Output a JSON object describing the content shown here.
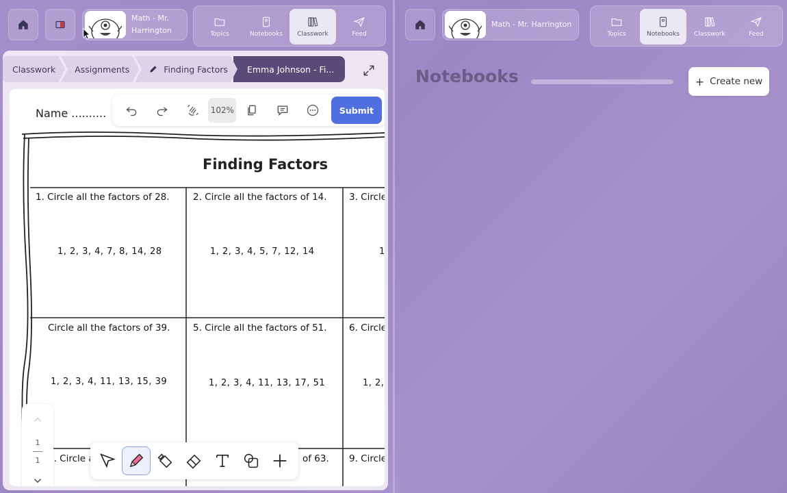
{
  "left_header": {
    "course": "Math - Mr. Harrington",
    "nav": [
      {
        "label": "Topics",
        "icon": "folder-icon",
        "active": false
      },
      {
        "label": "Notebooks",
        "icon": "notebook-icon",
        "active": false
      },
      {
        "label": "Classwork",
        "icon": "books-icon",
        "active": true
      },
      {
        "label": "Feed",
        "icon": "paper-plane-icon",
        "active": false
      }
    ]
  },
  "right_header": {
    "course": "Math - Mr. Harrington",
    "nav": [
      {
        "label": "Topics",
        "icon": "folder-icon",
        "active": false
      },
      {
        "label": "Notebooks",
        "icon": "notebook-icon",
        "active": true
      },
      {
        "label": "Classwork",
        "icon": "books-icon",
        "active": false
      },
      {
        "label": "Feed",
        "icon": "paper-plane-icon",
        "active": false
      }
    ]
  },
  "breadcrumbs": [
    "Classwork",
    "Assignments",
    "Finding Factors",
    "Emma Johnson - Fi..."
  ],
  "toolbar": {
    "zoom": "102%",
    "submit": "Submit"
  },
  "worksheet": {
    "name_label": "Name ..........",
    "name_tail": "e",
    "title": "Finding Factors",
    "questions": [
      {
        "q": "1. Circle all the factors of 28.",
        "a": "1, 2, 3, 4, 7, 8, 14, 28"
      },
      {
        "q": "2. Circle all the factors of 14.",
        "a": "1, 2, 3, 4, 5, 7, 12, 14"
      },
      {
        "q": "3. Circle",
        "a": "1"
      },
      {
        "q": "Circle all the factors of 39.",
        "a": "1, 2, 3, 4, 11, 13, 15, 39"
      },
      {
        "q": "5. Circle all the factors of 51.",
        "a": "1, 2, 3, 4, 11, 13,  17, 51"
      },
      {
        "q": "6. Circle",
        "a": "1, 2,"
      },
      {
        "q": "7. Circle all",
        "a": ""
      },
      {
        "q": "of 63.",
        "a": ""
      },
      {
        "q": "9. Circle",
        "a": ""
      }
    ]
  },
  "pager": {
    "current": "1",
    "total": "1"
  },
  "notebooks": {
    "title": "Notebooks",
    "create_label": "Create new"
  }
}
